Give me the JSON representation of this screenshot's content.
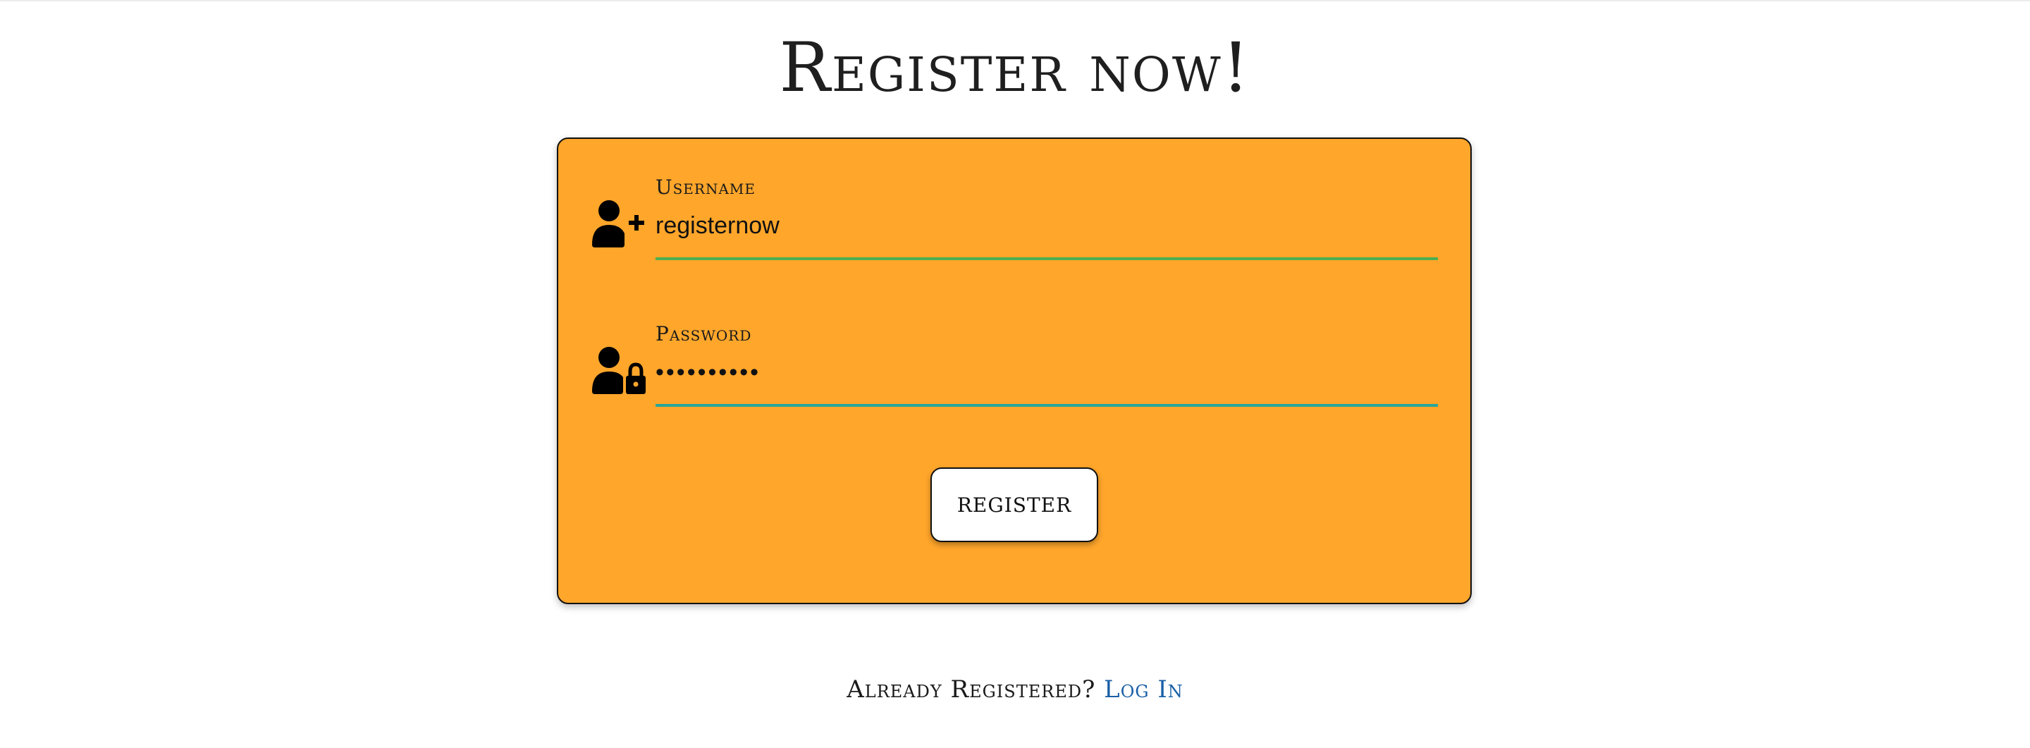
{
  "page": {
    "title": "Register now!"
  },
  "form": {
    "username": {
      "label": "Username",
      "value": "registernow",
      "icon": "user-plus-icon",
      "underline_color": "#4caf50"
    },
    "password": {
      "label": "Password",
      "value": "••••••••••",
      "icon": "user-lock-icon",
      "underline_color": "#26a69a"
    },
    "submit_label": "REGISTER"
  },
  "footer": {
    "prompt": "Already Registered?",
    "login_link": "Log In"
  },
  "colors": {
    "card_background": "#ffa62b",
    "link": "#1a5fa5"
  }
}
